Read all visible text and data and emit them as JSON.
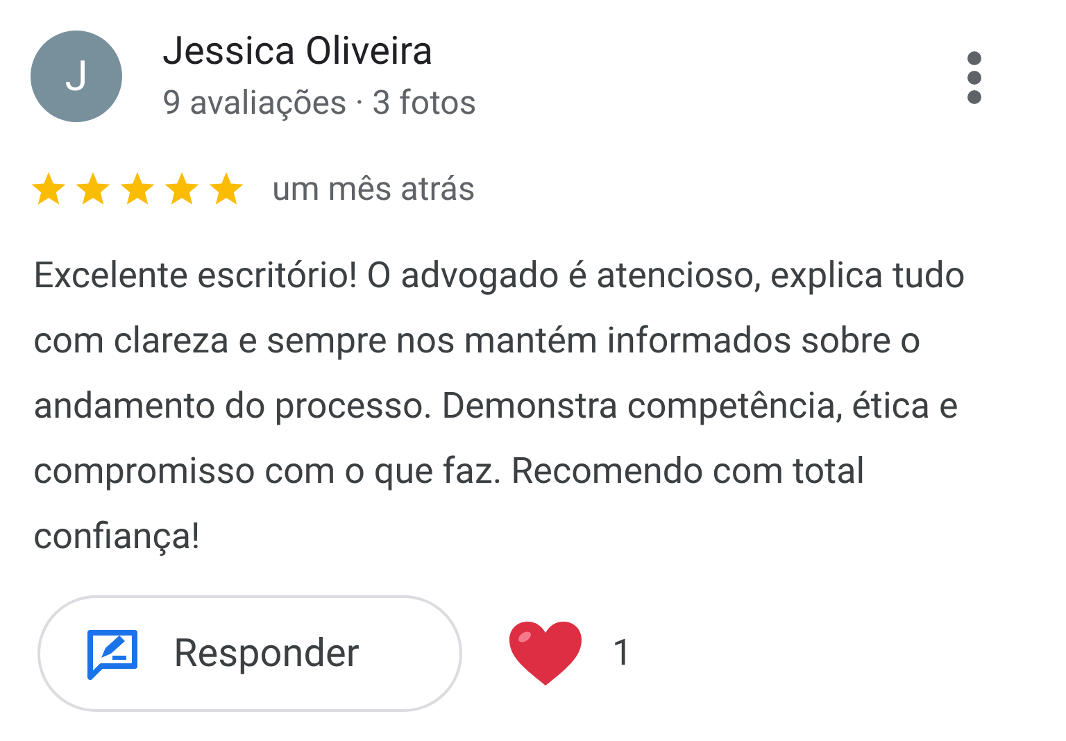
{
  "reviewer": {
    "initial": "J",
    "name": "Jessica Oliveira",
    "meta": "9 avaliações · 3 fotos"
  },
  "rating": {
    "stars": 5,
    "time": "um mês atrás"
  },
  "text": "Excelente escritório! O advogado é atencioso, explica tudo com clareza e sempre nos mantém informados sobre o andamento do processo. Demonstra competência, ética e compromisso com o que faz. Recomendo com total confiança!",
  "actions": {
    "reply_label": "Responder",
    "likes": "1"
  }
}
